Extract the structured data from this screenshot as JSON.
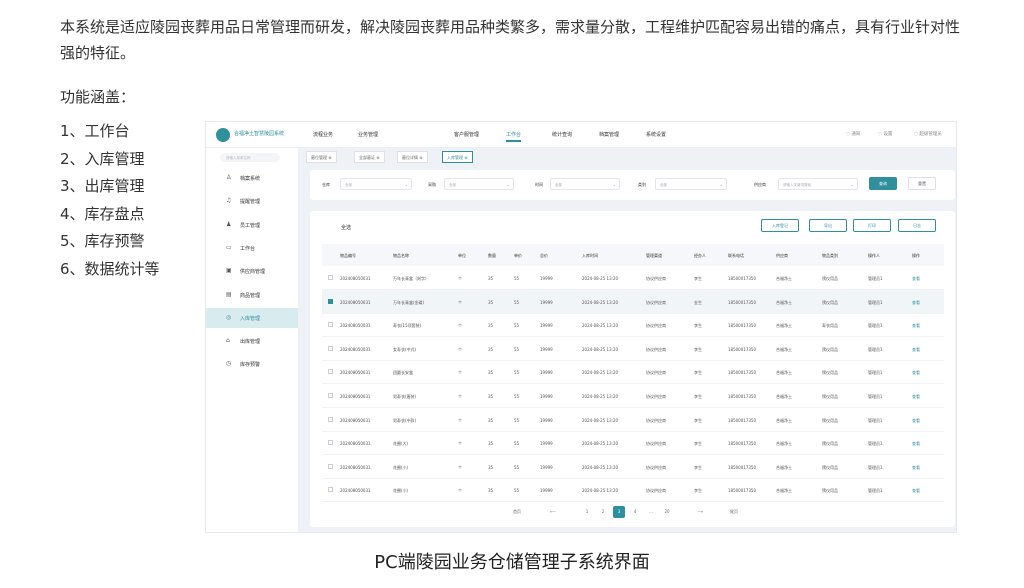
{
  "intro": "本系统是适应陵园丧葬用品日常管理而研发，解决陵园丧葬用品种类繁多，需求量分散，工程维护匹配容易出错的痛点，具有行业针对性强的特征。",
  "features_title": "功能涵盖：",
  "features": [
    "1、工作台",
    "2、入库管理",
    "3、出库管理",
    "4、库存盘点",
    "5、库存预警",
    "6、数据统计等"
  ],
  "app": {
    "name": "合福净土智慧陵园系统",
    "topnav": [
      {
        "label": "流程业务",
        "active": false
      },
      {
        "label": "业务管理",
        "active": false
      },
      {
        "label": "客户服管理",
        "active": false
      },
      {
        "label": "工作台",
        "active": true
      },
      {
        "label": "统计查询",
        "active": false
      },
      {
        "label": "档案管理",
        "active": false
      },
      {
        "label": "系统设置",
        "active": false
      }
    ],
    "tools": [
      "通知",
      "设置",
      "超级管理员"
    ],
    "sidebar": {
      "search_placeholder": "请输入菜单名称",
      "items": [
        {
          "label": "档案系统",
          "icon": "person-icon",
          "glyph": "♙",
          "active": false
        },
        {
          "label": "提醒管理",
          "icon": "bell-icon",
          "glyph": "♫",
          "active": false
        },
        {
          "label": "员工管理",
          "icon": "users-icon",
          "glyph": "♟",
          "active": false
        },
        {
          "label": "工作台",
          "icon": "desk-icon",
          "glyph": "▭",
          "active": false
        },
        {
          "label": "供应商管理",
          "icon": "supplier-icon",
          "glyph": "▣",
          "active": false
        },
        {
          "label": "商品管理",
          "icon": "goods-icon",
          "glyph": "▤",
          "active": false
        },
        {
          "label": "入库管理",
          "icon": "inbound-icon",
          "glyph": "◎",
          "active": true
        },
        {
          "label": "出库管理",
          "icon": "outbound-icon",
          "glyph": "⌂",
          "active": false
        },
        {
          "label": "库存预警",
          "icon": "warning-icon",
          "glyph": "◷",
          "active": false
        }
      ]
    },
    "tags": [
      {
        "label": "墓位管理 ⊗",
        "active": false
      },
      {
        "label": "全部墓证 ⊗",
        "active": false
      },
      {
        "label": "墓位详情 ⊗",
        "active": false
      },
      {
        "label": "入库管理 ⊗",
        "active": true
      }
    ],
    "filters": [
      {
        "label": "仓库",
        "placeholder": "全部"
      },
      {
        "label": "采购",
        "placeholder": "全部"
      },
      {
        "label": "时间",
        "placeholder": "全部"
      },
      {
        "label": "类别",
        "placeholder": "全部"
      },
      {
        "label": "供应商",
        "placeholder": "请输入关键词搜索"
      }
    ],
    "search_btn": "查询",
    "reset_btn": "重置",
    "panel_title": "全选",
    "actions": [
      "入库登记",
      "导出",
      "打印",
      "日志"
    ],
    "columns": [
      "物品编号",
      "物品名称",
      "单位",
      "数量",
      "单价",
      "总价",
      "入库时间",
      "管理渠道",
      "经办人",
      "联系电话",
      "供应商",
      "物品类别",
      "操作人",
      "操作"
    ],
    "rows": [
      {
        "checked": false,
        "cells": [
          "202408050031",
          "万年长青盒（刻字）",
          "个",
          "35",
          "55",
          "19999",
          "2024-08-25 13:20",
          "协议供应商",
          "李生",
          "18500017350",
          "合福净土",
          "殡仪用品",
          "管理员1",
          "查看"
        ]
      },
      {
        "checked": true,
        "cells": [
          "202408050031",
          "万年长青盒(金碟)",
          "个",
          "35",
          "55",
          "19999",
          "2024-08-25 13:20",
          "协议供应商",
          "金生",
          "18500017350",
          "合福净土",
          "殡仪用品",
          "管理员1",
          "查看"
        ]
      },
      {
        "checked": false,
        "cells": [
          "202408050031",
          "寿衣(15项套装)",
          "个",
          "35",
          "55",
          "19999",
          "2024-08-25 13:20",
          "协议供应商",
          "李生",
          "18500017350",
          "合福净土",
          "寿衣用品",
          "管理员1",
          "查看"
        ]
      },
      {
        "checked": false,
        "cells": [
          "202408050031",
          "女寿衣(中式)",
          "个",
          "35",
          "55",
          "19999",
          "2024-08-25 13:20",
          "协议供应商",
          "李生",
          "18500017350",
          "合福净土",
          "殡仪用品",
          "管理员1",
          "查看"
        ]
      },
      {
        "checked": false,
        "cells": [
          "202408050031",
          "团圆长安盒",
          "个",
          "35",
          "55",
          "19999",
          "2024-08-25 13:20",
          "协议供应商",
          "李生",
          "18500017350",
          "合福净土",
          "殡仪用品",
          "管理员1",
          "查看"
        ]
      },
      {
        "checked": false,
        "cells": [
          "202408050031",
          "男寿衣(唐装)",
          "个",
          "35",
          "55",
          "19999",
          "2024-08-25 13:20",
          "协议供应商",
          "李生",
          "18500017350",
          "合福净土",
          "殡仪用品",
          "管理员1",
          "查看"
        ]
      },
      {
        "checked": false,
        "cells": [
          "202408050031",
          "男寿衣(中款)",
          "个",
          "35",
          "55",
          "19999",
          "2024-08-25 13:20",
          "协议供应商",
          "李生",
          "18500017350",
          "合福净土",
          "殡仪用品",
          "管理员1",
          "查看"
        ]
      },
      {
        "checked": false,
        "cells": [
          "202408050031",
          "花圈(大)",
          "个",
          "35",
          "55",
          "19999",
          "2024-08-25 13:20",
          "协议供应商",
          "李生",
          "18500017350",
          "合福净土",
          "殡仪用品",
          "管理员1",
          "查看"
        ]
      },
      {
        "checked": false,
        "cells": [
          "202408050031",
          "花圈(小)",
          "个",
          "35",
          "55",
          "19999",
          "2024-08-25 13:20",
          "协议供应商",
          "李生",
          "18500017350",
          "合福净土",
          "殡仪用品",
          "管理员1",
          "查看"
        ]
      },
      {
        "checked": false,
        "cells": [
          "202408050031",
          "花圈(小)",
          "个",
          "35",
          "55",
          "19999",
          "2024-08-25 13:20",
          "协议供应商",
          "李生",
          "18500017350",
          "合福净土",
          "殡仪用品",
          "管理员1",
          "查看"
        ]
      }
    ],
    "pager": {
      "first": "首页",
      "prev": "⟵",
      "pages": [
        "1",
        "2",
        "3",
        "4",
        "...",
        "20"
      ],
      "active_page": "3",
      "next": "⟶",
      "last": "尾页"
    }
  },
  "caption": "PC端陵园业务仓储管理子系统界面"
}
